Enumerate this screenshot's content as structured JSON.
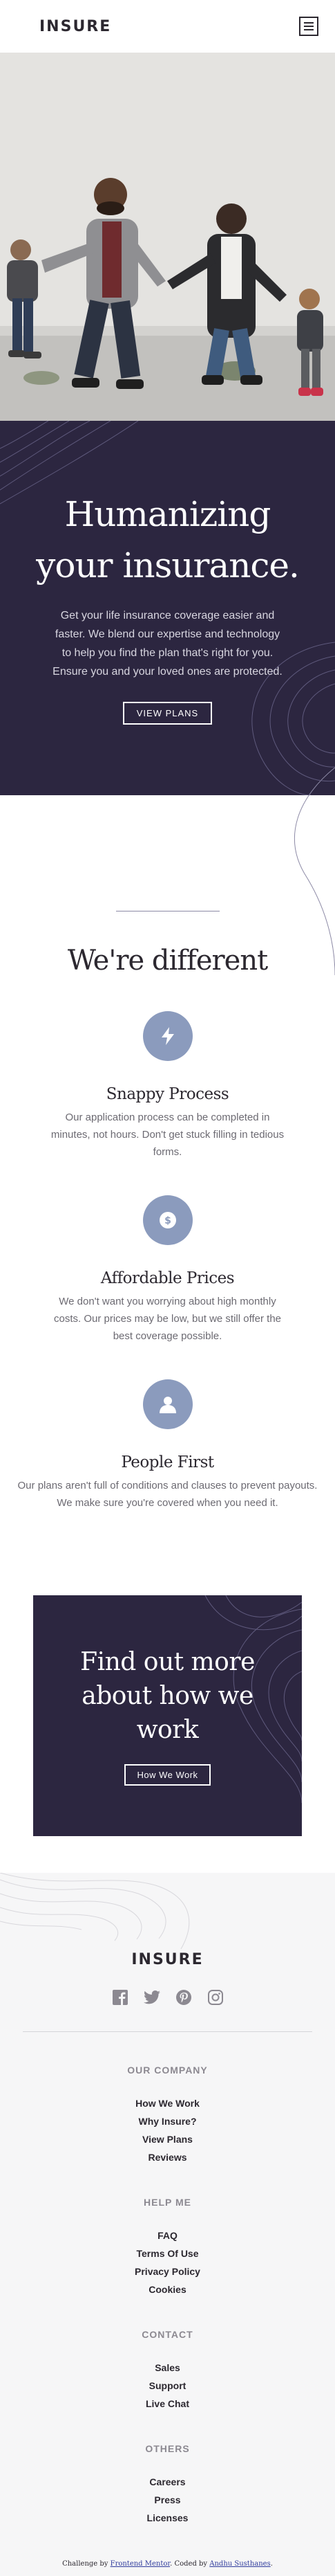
{
  "header": {
    "logo": "INSURE",
    "menu_icon": "hamburger-menu-icon"
  },
  "hero": {
    "image_alt": "family-walking-photo",
    "title_line1": "Humanizing",
    "title_line2": "your insurance.",
    "description": "Get your life insurance coverage easier and faster. We blend our expertise and technology to help you find the plan that's right for you. Ensure you and your loved ones are protected.",
    "button_label": "VIEW PLANS"
  },
  "different": {
    "title": "We're different",
    "features": [
      {
        "icon": "lightning-icon",
        "title": "Snappy Process",
        "text": "Our application process can be completed in minutes, not hours. Don't get stuck filling in tedious forms."
      },
      {
        "icon": "dollar-icon",
        "title": "Affordable Prices",
        "text": "We don't want you worrying about high monthly costs. Our prices may be low, but we still offer the best coverage possible."
      },
      {
        "icon": "person-icon",
        "title": "People First",
        "text": "Our plans aren't full of conditions and clauses to prevent payouts. We make sure you're covered when you need it."
      }
    ]
  },
  "cta": {
    "title": "Find out more about how we work",
    "button_label": "How We Work"
  },
  "footer": {
    "logo": "INSURE",
    "socials": [
      "facebook-icon",
      "twitter-icon",
      "pinterest-icon",
      "instagram-icon"
    ],
    "groups": [
      {
        "title": "OUR COMPANY",
        "links": [
          "How We Work",
          "Why Insure?",
          "View Plans",
          "Reviews"
        ]
      },
      {
        "title": "HELP ME",
        "links": [
          "FAQ",
          "Terms Of Use",
          "Privacy Policy",
          "Cookies"
        ]
      },
      {
        "title": "CONTACT",
        "links": [
          "Sales",
          "Support",
          "Live Chat"
        ]
      },
      {
        "title": "OTHERS",
        "links": [
          "Careers",
          "Press",
          "Licenses"
        ]
      }
    ],
    "attribution": {
      "prefix": "Challenge by",
      "mentor": "Frontend Mentor",
      "middle": ". Coded by",
      "coder": "Andhu Susthanes",
      "suffix": "."
    }
  },
  "colors": {
    "dark_violet": "#2c2640",
    "grayish_blue": "#8b9bbd",
    "very_light_gray": "#f6f6f7"
  }
}
